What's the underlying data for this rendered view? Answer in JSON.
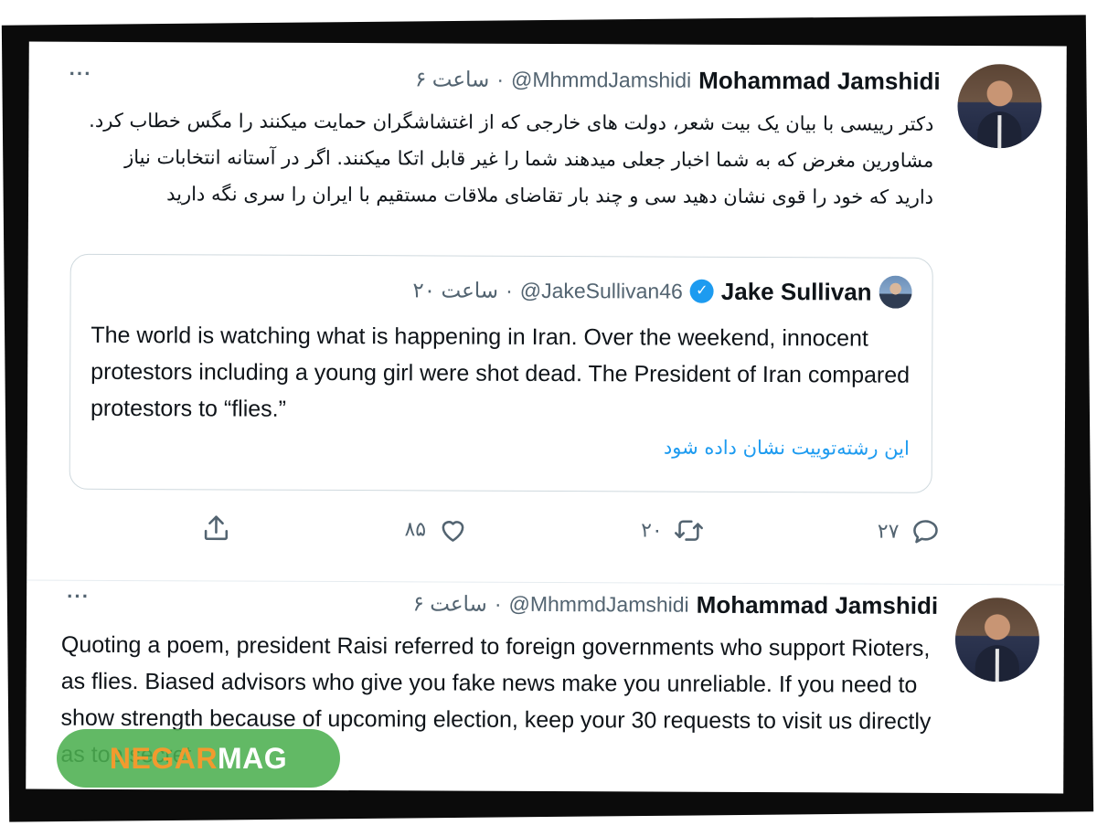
{
  "tweets": [
    {
      "author_name": "Mohammad Jamshidi",
      "handle": "@MhmmdJamshidi",
      "separator": "·",
      "time": "۶ ساعت",
      "more": "···",
      "text": "دکتر رییسی با بیان یک بیت شعر، دولت های خارجی که از اغتشاشگران حمایت میکنند را مگس خطاب کرد. مشاورین مغرض که به شما اخبار جعلی میدهند شما را غیر قابل اتکا میکنند. اگر در آستانه انتخابات نیاز دارید که خود را قوی نشان دهید سی و چند بار تقاضای ملاقات مستقیم با ایران را سری نگه دارید",
      "quote": {
        "author_name": "Jake Sullivan",
        "verified_glyph": "✓",
        "handle": "@JakeSullivan46",
        "separator": "·",
        "time": "۲۰ ساعت",
        "text": "The world is watching what is happening in Iran. Over the weekend, innocent protestors including a young girl were shot dead. The President of Iran compared protestors to “flies.”",
        "show_thread": "این رشته‌توییت نشان داده شود"
      },
      "actions": {
        "reply_count": "۲۷",
        "retweet_count": "۲۰",
        "like_count": "۸۵",
        "icons": [
          "reply-icon",
          "retweet-icon",
          "like-icon",
          "share-icon"
        ]
      }
    },
    {
      "author_name": "Mohammad Jamshidi",
      "handle": "@MhmmdJamshidi",
      "separator": "·",
      "time": "۶ ساعت",
      "more": "···",
      "text": "Quoting a poem, president Raisi referred to foreign governments who support Rioters, as flies. Biased advisors who give you fake news make you unreliable. If you need to show strength because of upcoming election, keep your 30 requests to visit us directly as top secret"
    }
  ],
  "watermark": {
    "part1": "NEGAR",
    "part2": "MAG"
  },
  "colors": {
    "accent": "#1d9bf0",
    "text": "#0f1419",
    "muted": "#536471",
    "watermark_bg": "#4caf50",
    "watermark_orange": "#f29a2e"
  }
}
